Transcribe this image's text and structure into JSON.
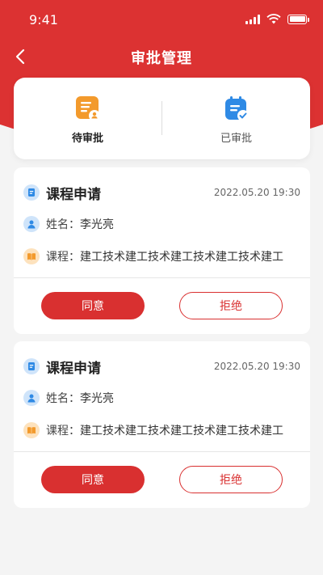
{
  "status_bar": {
    "time": "9:41"
  },
  "nav": {
    "title": "审批管理",
    "back_icon": "chevron-left-icon"
  },
  "tabs": [
    {
      "label": "待审批",
      "icon": "pending-approval-icon",
      "icon_color": "#f39a2c",
      "active": true
    },
    {
      "label": "已审批",
      "icon": "approved-icon",
      "icon_color": "#2f8ae5",
      "active": false
    }
  ],
  "applications": [
    {
      "title": "课程申请",
      "datetime": "2022.05.20 19:30",
      "name_label": "姓名：",
      "name": "李光亮",
      "course_label": "课程：",
      "course": "建工技术建工技术建工技术建工技术建工",
      "agree_label": "同意",
      "reject_label": "拒绝"
    },
    {
      "title": "课程申请",
      "datetime": "2022.05.20 19:30",
      "name_label": "姓名：",
      "name": "李光亮",
      "course_label": "课程：",
      "course": "建工技术建工技术建工技术建工技术建工",
      "agree_label": "同意",
      "reject_label": "拒绝"
    }
  ],
  "colors": {
    "brand_red": "#dc3232",
    "button_red": "#d93030",
    "background": "#f4f4f4"
  }
}
